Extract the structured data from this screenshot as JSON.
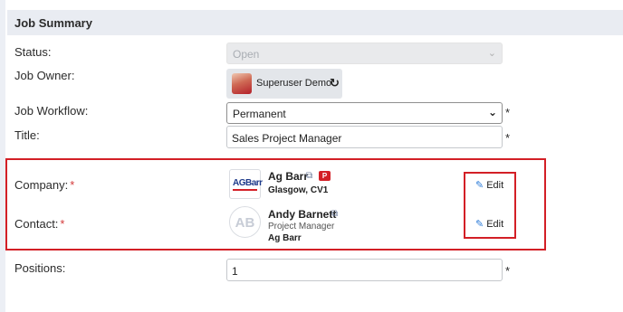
{
  "section": {
    "title": "Job Summary"
  },
  "status": {
    "label": "Status:",
    "value": "Open"
  },
  "owner": {
    "label": "Job Owner:",
    "name": "Superuser Demo"
  },
  "workflow": {
    "label": "Job Workflow:",
    "value": "Permanent",
    "required_mark": "*"
  },
  "title_field": {
    "label": "Title:",
    "value": "Sales Project Manager",
    "required_mark": "*"
  },
  "company": {
    "label": "Company:",
    "required_mark": "*",
    "logo_text": "AGBarr",
    "name": "Ag Barr",
    "badge": "P",
    "location": "Glasgow, CV1",
    "edit_label": "Edit"
  },
  "contact": {
    "label": "Contact:",
    "required_mark": "*",
    "initials": "AB",
    "name": "Andy Barnett",
    "job_title": "Project Manager",
    "company": "Ag Barr",
    "edit_label": "Edit"
  },
  "positions": {
    "label": "Positions:",
    "value": "1",
    "required_mark": "*"
  },
  "icons": {
    "chevron": "chevron-down-icon",
    "refresh": "refresh-icon",
    "external": "external-link-icon",
    "pencil": "pencil-icon"
  },
  "colors": {
    "accent": "#2b7bd8",
    "highlight": "#d31f26",
    "header_bg": "#e9ecf2"
  }
}
